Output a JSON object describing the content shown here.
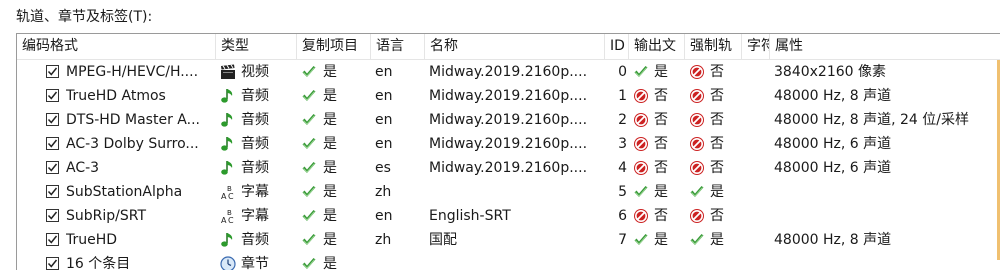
{
  "section": {
    "title": "轨道、章节及标签(T):"
  },
  "columns": {
    "codec": "编码格式",
    "type": "类型",
    "copy": "复制项目",
    "lang": "语言",
    "name": "名称",
    "id": "ID",
    "output": "输出文",
    "forced": "强制轨",
    "char": "字符",
    "props": "属性"
  },
  "rows": [
    {
      "codec": "MPEG-H/HEVC/H....",
      "type_icon": "video-icon",
      "type": "视频",
      "copy": "是",
      "lang": "en",
      "name": "Midway.2019.2160p....",
      "id": "0",
      "output_icon": "check-icon",
      "output": "是",
      "forced_icon": "no-icon",
      "forced": "否",
      "props": "3840x2160 像素"
    },
    {
      "codec": "TrueHD Atmos",
      "type_icon": "audio-icon",
      "type": "音频",
      "copy": "是",
      "lang": "en",
      "name": "Midway.2019.2160p....",
      "id": "1",
      "output_icon": "no-icon",
      "output": "否",
      "forced_icon": "no-icon",
      "forced": "否",
      "props": "48000 Hz, 8 声道"
    },
    {
      "codec": "DTS-HD Master A...",
      "type_icon": "audio-icon",
      "type": "音频",
      "copy": "是",
      "lang": "en",
      "name": "Midway.2019.2160p....",
      "id": "2",
      "output_icon": "no-icon",
      "output": "否",
      "forced_icon": "no-icon",
      "forced": "否",
      "props": "48000 Hz, 8 声道, 24 位/采样"
    },
    {
      "codec": "AC-3 Dolby Surro...",
      "type_icon": "audio-icon",
      "type": "音频",
      "copy": "是",
      "lang": "en",
      "name": "Midway.2019.2160p....",
      "id": "3",
      "output_icon": "no-icon",
      "output": "否",
      "forced_icon": "no-icon",
      "forced": "否",
      "props": "48000 Hz, 6 声道"
    },
    {
      "codec": "AC-3",
      "type_icon": "audio-icon",
      "type": "音频",
      "copy": "是",
      "lang": "es",
      "name": "Midway.2019.2160p....",
      "id": "4",
      "output_icon": "no-icon",
      "output": "否",
      "forced_icon": "no-icon",
      "forced": "否",
      "props": "48000 Hz, 6 声道"
    },
    {
      "codec": "SubStationAlpha",
      "type_icon": "subtitle-icon",
      "type": "字幕",
      "copy": "是",
      "lang": "zh",
      "name": "",
      "id": "5",
      "output_icon": "check-icon",
      "output": "是",
      "forced_icon": "check-icon",
      "forced": "是",
      "props": ""
    },
    {
      "codec": "SubRip/SRT",
      "type_icon": "subtitle-icon",
      "type": "字幕",
      "copy": "是",
      "lang": "en",
      "name": "English-SRT",
      "id": "6",
      "output_icon": "no-icon",
      "output": "否",
      "forced_icon": "no-icon",
      "forced": "否",
      "props": ""
    },
    {
      "codec": "TrueHD",
      "type_icon": "audio-icon",
      "type": "音频",
      "copy": "是",
      "lang": "zh",
      "name": "国配",
      "id": "7",
      "output_icon": "check-icon",
      "output": "是",
      "forced_icon": "check-icon",
      "forced": "是",
      "props": "48000 Hz, 8 声道"
    },
    {
      "codec": "16 个条目",
      "type_icon": "chapter-icon",
      "type": "章节",
      "copy": "是",
      "lang": "",
      "name": "",
      "id": "",
      "output_icon": "",
      "output": "",
      "forced_icon": "",
      "forced": "",
      "props": ""
    }
  ],
  "colors": {
    "check_green": "#3a9a3a",
    "no_red": "#cc2222",
    "border": "#9a9a9a",
    "accent": "#f0c070"
  }
}
